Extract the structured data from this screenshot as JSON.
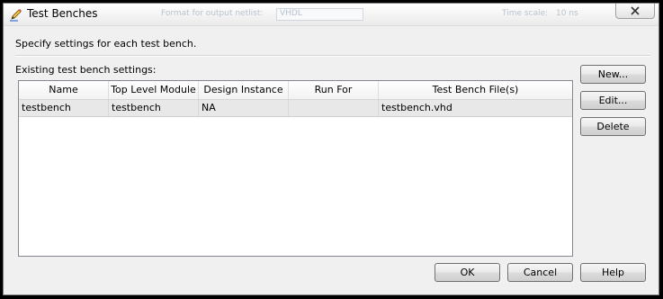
{
  "window": {
    "title": "Test Benches"
  },
  "background": {
    "ghost_label_1": "Format for output netlist:",
    "ghost_select": "VHDL",
    "ghost_label_2": "Time scale:",
    "ghost_label_3": "10 ns"
  },
  "instructions": "Specify settings for each test bench.",
  "list_label": "Existing test bench settings:",
  "table": {
    "columns": [
      "Name",
      "Top Level Module",
      "Design Instance",
      "Run For",
      "Test Bench File(s)"
    ],
    "rows": [
      [
        "testbench",
        "testbench",
        "NA",
        "",
        "testbench.vhd"
      ]
    ]
  },
  "buttons": {
    "new": "New...",
    "edit": "Edit...",
    "delete": "Delete",
    "ok": "OK",
    "cancel": "Cancel",
    "help": "Help"
  },
  "icons": {
    "title": "pencil-icon",
    "close": "close-icon"
  }
}
